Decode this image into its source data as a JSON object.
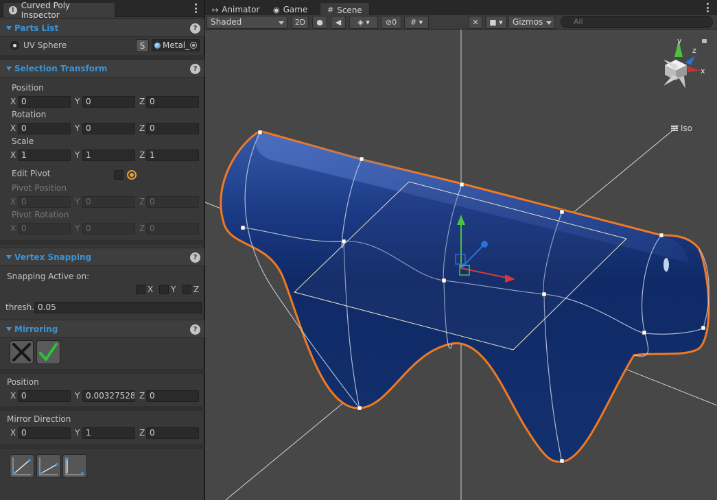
{
  "inspector": {
    "tab_title": "Curved Poly Inspector",
    "tab_icon": "info-icon",
    "parts_list": {
      "header": "Parts List",
      "help": "?",
      "item_label": "UV Sphere",
      "solo_button": "S",
      "material_name": "Metal_"
    },
    "selection_transform": {
      "header": "Selection Transform",
      "help": "?",
      "position_label": "Position",
      "position": {
        "x": "0",
        "y": "0",
        "z": "0"
      },
      "rotation_label": "Rotation",
      "rotation": {
        "x": "0",
        "y": "0",
        "z": "0"
      },
      "scale_label": "Scale",
      "scale": {
        "x": "1",
        "y": "1",
        "z": "1"
      },
      "edit_pivot_label": "Edit Pivot",
      "pivot_position_label": "Pivot Position",
      "pivot_position": {
        "x": "0",
        "y": "0",
        "z": "0"
      },
      "pivot_rotation_label": "Pivot Rotation",
      "pivot_rotation": {
        "x": "0",
        "y": "0",
        "z": "0"
      }
    },
    "axis_labels": {
      "x": "X",
      "y": "Y",
      "z": "Z"
    },
    "vertex_snapping": {
      "header": "Vertex Snapping",
      "help": "?",
      "active_on_label": "Snapping Active on:",
      "threshold_label": "thresh.",
      "threshold_value": "0.05"
    },
    "mirroring": {
      "header": "Mirroring",
      "help": "?",
      "position_label": "Position",
      "position": {
        "x": "0",
        "y": "0.00327528",
        "z": "0"
      },
      "direction_label": "Mirror Direction",
      "direction": {
        "x": "0",
        "y": "1",
        "z": "0"
      }
    }
  },
  "scene": {
    "tabs": [
      {
        "label": "Animator",
        "icon": "animator-icon"
      },
      {
        "label": "Game",
        "icon": "game-controller-icon"
      },
      {
        "label": "Scene",
        "icon": "scene-grid-icon"
      }
    ],
    "active_tab": "Scene",
    "toolbar": {
      "shading_mode": "Shaded",
      "mode_2d": "2D",
      "hidden_count": "0",
      "gizmos_label": "Gizmos",
      "search_placeholder": "All"
    },
    "orientation_gizmo": {
      "x": "x",
      "y": "y",
      "z": "z",
      "projection": "Iso"
    }
  },
  "colors": {
    "accent": "#3a93d6",
    "selection_outline": "#f07a23",
    "mesh_fill": "#1c3a7a",
    "x_axis": "#d23a3a",
    "y_axis": "#4cc23a",
    "z_axis": "#2f6fd8",
    "pivot": "#e8a13a"
  }
}
